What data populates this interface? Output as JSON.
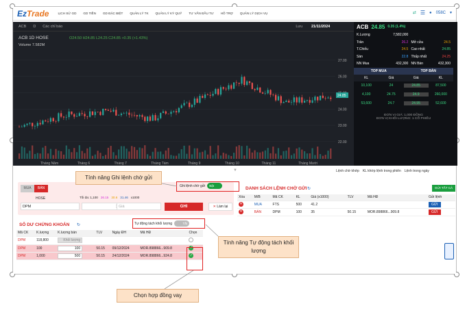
{
  "app": {
    "logo_a": "Ez",
    "logo_b": "Trade"
  },
  "nav": [
    "LỊCH SỬ GD",
    "GD TIỀN",
    "GD ĐẶC BIỆT",
    "QUẢN LÝ TK",
    "QUẢN LÝ KÝ QUỸ",
    "TƯ VẤN ĐẦU TƯ",
    "HỖ TRỢ",
    "QUẢN LÝ DỊCH VỤ"
  ],
  "account": "058C",
  "chart": {
    "symbol_bar": "ACB",
    "tools": [
      "D",
      "Các chỉ báo",
      "Lưu"
    ],
    "header": "ACB 1D HOSE",
    "ohlc": "O24.50 H24.85 L24.25 C24.85 +0.35 (+1.43%)",
    "volume": "Volume 7.582M",
    "date": "21/11/2024",
    "yticks": [
      "27.00",
      "26.00",
      "25.00",
      "24.00",
      "23.00",
      "22.00"
    ],
    "price_tag": "24.85",
    "xticks": [
      "Tháng Năm",
      "Tháng 6",
      "Tháng 7",
      "Tháng Tám",
      "Tháng 9",
      "Tháng 10",
      "Tháng 11",
      "Tháng Mười"
    ]
  },
  "chart_data": {
    "type": "line",
    "x": [
      "Tháng Năm",
      "Tháng 6",
      "Tháng 7",
      "Tháng Tám",
      "Tháng 9",
      "Tháng 10",
      "Tháng 11"
    ],
    "values": [
      22.9,
      23.6,
      23.9,
      23.4,
      24.5,
      25.8,
      24.4,
      24.85
    ],
    "ylim": [
      21.7,
      27.5
    ]
  },
  "quote": {
    "symbol": "ACB",
    "price": "24.85",
    "change": "0.35 (1.4%)",
    "rows": [
      [
        "K.Lượng",
        "7,582,000",
        "",
        ""
      ],
      [
        "Trần",
        "26.2",
        "Mở cửa",
        "24.5"
      ],
      [
        "T.Chiếu",
        "24.5",
        "Cao nhất",
        "24.85"
      ],
      [
        "Sàn",
        "22.8",
        "Thấp nhất",
        "24.25"
      ],
      [
        "NN Mua",
        "432,300",
        "NN Bán",
        "432,300"
      ]
    ],
    "top_buy": "TOP MUA",
    "top_sell": "TOP BÁN",
    "cols": [
      "KL",
      "Giá",
      "Giá",
      "KL"
    ],
    "book": [
      [
        "10,100",
        "24",
        "24.85",
        "87,500"
      ],
      [
        "4,100",
        "24.75",
        "24.9",
        "260,000"
      ],
      [
        "53,600",
        "24.7",
        "24.95",
        "52,600"
      ]
    ],
    "unit1": "ĐƠN VỊ GIÁ: 1,000 ĐỒNG",
    "unit2": "ĐƠN VỊ KHỐI LƯỢNG: 1 CỔ PHIẾU"
  },
  "tabs": [
    "Lệnh chờ khớp",
    "KL khớp lệnh trong phiên",
    "Lệnh trong ngày"
  ],
  "order": {
    "buy": "MUA",
    "sell": "BÁN",
    "exchange": "HOSE",
    "max_label": "Tối đa: 1,100",
    "p1": "26.15",
    "p2": "30.6",
    "p3": "31.46",
    "p4": "x1000",
    "symbol": "DPM",
    "qty": "100",
    "price_ph": "Giá",
    "submit": "GHI",
    "reset": "Làm lại",
    "pending_toggle": "Ghi lệnh chờ gửi",
    "toggle_on": "Bật"
  },
  "pending": {
    "title": "DANH SÁCH LỆNH CHỜ GỬI",
    "send_all": "GỬI TẤT CẢ",
    "cols": [
      "Xóa",
      "M/B",
      "Mã CK",
      "KL",
      "Giá (x1000)",
      "TLV",
      "Mã HĐ",
      "Gửi lệnh"
    ],
    "rows": [
      [
        "MUA",
        "FTS",
        "500",
        "41.2",
        "",
        "",
        "GỬI"
      ],
      [
        "BÁN",
        "DPM",
        "100",
        "35",
        "50.15",
        "MOR.898866...909.8",
        "GỬI"
      ]
    ]
  },
  "holdings": {
    "title": "SỐ DƯ CHỨNG KHOÁN",
    "split_label": "Tự động tách khối lượng",
    "toggle_off": "Tắt",
    "cols": [
      "Mã CK",
      "K.lượng",
      "K.lượng bán",
      "TLV",
      "Ngày ĐH",
      "Mã HĐ",
      "Chọn"
    ],
    "rows": [
      [
        "DPM",
        "118,800",
        "Khối lượng",
        "",
        "",
        "",
        ""
      ],
      [
        "DPM",
        "100",
        "100",
        "50.15",
        "09/12/2024",
        "MOR.898866...909.8",
        "v"
      ],
      [
        "DPM",
        "1,000",
        "500",
        "50.15",
        "24/12/2024",
        "MOR.898866...924.8",
        "v"
      ]
    ]
  },
  "callouts": {
    "c1": "Tính năng Ghi lệnh chờ gửi",
    "c2": "Tính năng Tự động tách khối lượng",
    "c3": "Chọn hợp đồng vay"
  }
}
